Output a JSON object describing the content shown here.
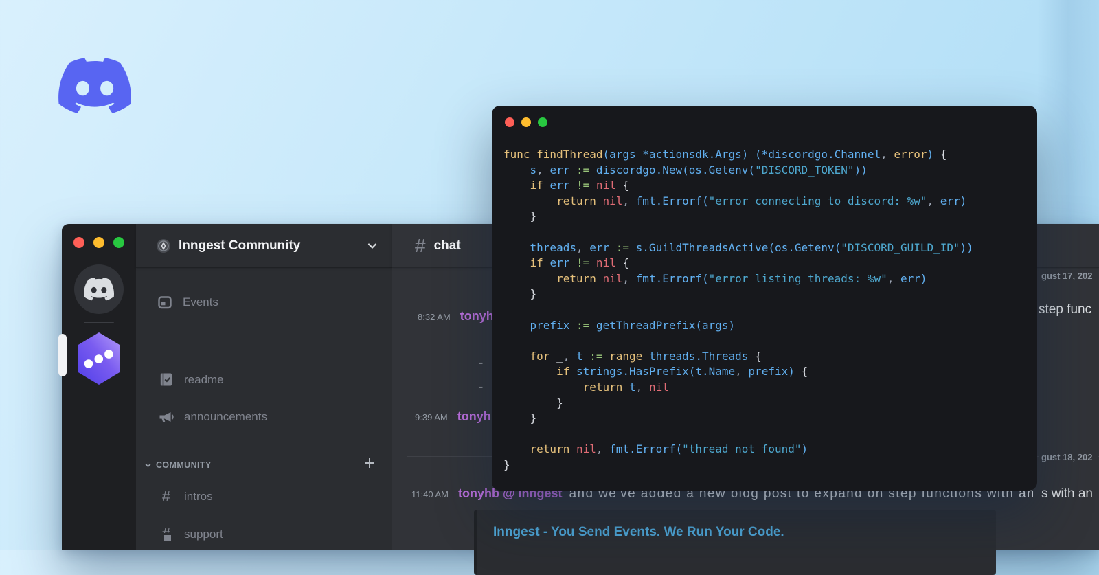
{
  "colors": {
    "blurple": "#5865F2",
    "traffic_red": "#ff5f57",
    "traffic_yellow": "#febc2e",
    "traffic_green": "#28c840",
    "username_purple": "#bb6fdd",
    "embed_title_blue": "#4FA8D8"
  },
  "sidebar": {
    "server_name": "Inngest Community",
    "events": {
      "label": "Events"
    },
    "channels": [
      {
        "icon": "book-check",
        "label": "readme"
      },
      {
        "icon": "megaphone",
        "label": "announcements"
      }
    ],
    "category": {
      "label": "COMMUNITY",
      "add": "+"
    },
    "category_channels": [
      {
        "icon": "hash",
        "label": "intros"
      },
      {
        "icon": "hash-bubble",
        "label": "support"
      }
    ]
  },
  "chat": {
    "channel": "chat",
    "date_fragment_aug17": "gust 17, 202",
    "msg_832": {
      "time": "8:32 AM",
      "user": "tonyhb"
    },
    "fragment_step": "step func",
    "bullets": [
      "-",
      "-"
    ],
    "msg_939": {
      "time": "9:39 AM",
      "user": "tonyhb"
    },
    "date_fragment_aug18": "gust 18, 202",
    "msg_1140": {
      "time": "11:40 AM",
      "user": "tonyhb @ inngest",
      "text": "and we've added a new blog post to expand on step functions with an"
    },
    "fragment_tail": "s with an",
    "embed": {
      "title": "Inngest - You Send Events. We Run Your Code."
    }
  },
  "code_window": {
    "lines": [
      [
        [
          "k",
          "func findThread"
        ],
        [
          "i",
          "(args *actionsdk.Args) (*discordgo.Channel"
        ],
        [
          "p",
          ", "
        ],
        [
          "k",
          "error"
        ],
        [
          "i",
          ")"
        ],
        [
          "b",
          " {"
        ]
      ],
      [
        [
          "w",
          "    "
        ],
        [
          "i",
          "s"
        ],
        [
          "p",
          ", "
        ],
        [
          "i",
          "err "
        ],
        [
          "o",
          ":="
        ],
        [
          "i",
          " discordgo.New(os.Getenv("
        ],
        [
          "s",
          "\"DISCORD_TOKEN\""
        ],
        [
          "i",
          "))"
        ]
      ],
      [
        [
          "w",
          "    "
        ],
        [
          "k",
          "if "
        ],
        [
          "i",
          "err "
        ],
        [
          "o",
          "!="
        ],
        [
          "n",
          " nil"
        ],
        [
          "b",
          " {"
        ]
      ],
      [
        [
          "w",
          "        "
        ],
        [
          "k",
          "return "
        ],
        [
          "n",
          "nil"
        ],
        [
          "p",
          ", "
        ],
        [
          "i",
          "fmt.Errorf("
        ],
        [
          "s",
          "\"error connecting to discord: %w\""
        ],
        [
          "p",
          ", "
        ],
        [
          "i",
          "err)"
        ]
      ],
      [
        [
          "w",
          "    "
        ],
        [
          "b",
          "}"
        ]
      ],
      [],
      [
        [
          "w",
          "    "
        ],
        [
          "i",
          "threads"
        ],
        [
          "p",
          ", "
        ],
        [
          "i",
          "err "
        ],
        [
          "o",
          ":="
        ],
        [
          "i",
          " s.GuildThreadsActive(os.Getenv("
        ],
        [
          "s",
          "\"DISCORD_GUILD_ID\""
        ],
        [
          "i",
          "))"
        ]
      ],
      [
        [
          "w",
          "    "
        ],
        [
          "k",
          "if "
        ],
        [
          "i",
          "err "
        ],
        [
          "o",
          "!="
        ],
        [
          "n",
          " nil"
        ],
        [
          "b",
          " {"
        ]
      ],
      [
        [
          "w",
          "        "
        ],
        [
          "k",
          "return "
        ],
        [
          "n",
          "nil"
        ],
        [
          "p",
          ", "
        ],
        [
          "i",
          "fmt.Errorf("
        ],
        [
          "s",
          "\"error listing threads: %w\""
        ],
        [
          "p",
          ", "
        ],
        [
          "i",
          "err)"
        ]
      ],
      [
        [
          "w",
          "    "
        ],
        [
          "b",
          "}"
        ]
      ],
      [],
      [
        [
          "w",
          "    "
        ],
        [
          "i",
          "prefix "
        ],
        [
          "o",
          ":="
        ],
        [
          "i",
          " getThreadPrefix(args)"
        ]
      ],
      [],
      [
        [
          "w",
          "    "
        ],
        [
          "k",
          "for "
        ],
        [
          "w",
          "_"
        ],
        [
          "p",
          ", "
        ],
        [
          "i",
          "t "
        ],
        [
          "o",
          ":="
        ],
        [
          "k",
          " range "
        ],
        [
          "i",
          "threads.Threads"
        ],
        [
          "b",
          " {"
        ]
      ],
      [
        [
          "w",
          "        "
        ],
        [
          "k",
          "if "
        ],
        [
          "i",
          "strings.HasPrefix(t.Name"
        ],
        [
          "p",
          ", "
        ],
        [
          "i",
          "prefix)"
        ],
        [
          "b",
          " {"
        ]
      ],
      [
        [
          "w",
          "            "
        ],
        [
          "k",
          "return "
        ],
        [
          "i",
          "t"
        ],
        [
          "p",
          ", "
        ],
        [
          "n",
          "nil"
        ]
      ],
      [
        [
          "w",
          "        "
        ],
        [
          "b",
          "}"
        ]
      ],
      [
        [
          "w",
          "    "
        ],
        [
          "b",
          "}"
        ]
      ],
      [],
      [
        [
          "w",
          "    "
        ],
        [
          "k",
          "return "
        ],
        [
          "n",
          "nil"
        ],
        [
          "p",
          ", "
        ],
        [
          "i",
          "fmt.Errorf("
        ],
        [
          "s",
          "\"thread not found\""
        ],
        [
          "i",
          ")"
        ]
      ],
      [
        [
          "b",
          "}"
        ]
      ]
    ]
  }
}
